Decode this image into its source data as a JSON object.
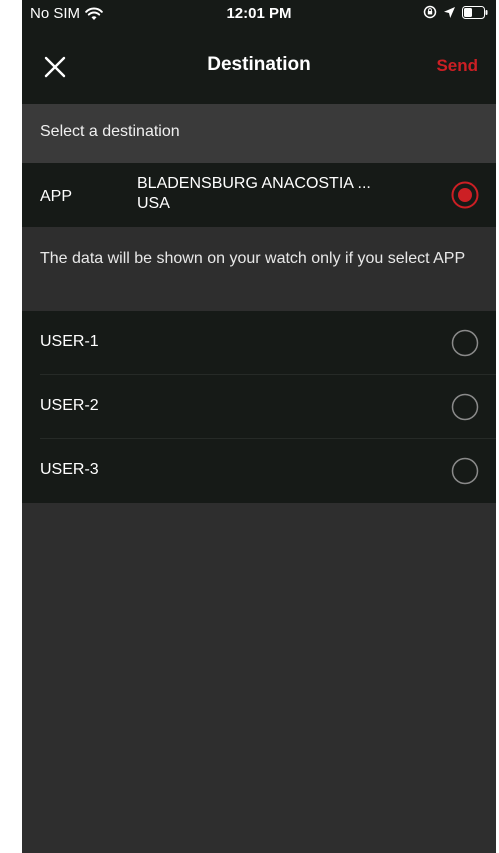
{
  "status_bar": {
    "carrier": "No SIM",
    "time": "12:01 PM"
  },
  "nav": {
    "title": "Destination",
    "send_label": "Send",
    "close_icon": "close-icon"
  },
  "section_header": "Select a destination",
  "app_destination": {
    "label": "APP",
    "location_line1": "BLADENSBURG  ANACOSTIA ...",
    "location_line2": "USA",
    "selected": true
  },
  "info_text": "The data will be shown on your watch only if you select APP",
  "users": [
    {
      "label": "USER-1",
      "selected": false
    },
    {
      "label": "USER-2",
      "selected": false
    },
    {
      "label": "USER-3",
      "selected": false
    }
  ],
  "colors": {
    "accent": "#cc1f24",
    "dark_row": "#161a17",
    "background": "#2e2e2e"
  }
}
